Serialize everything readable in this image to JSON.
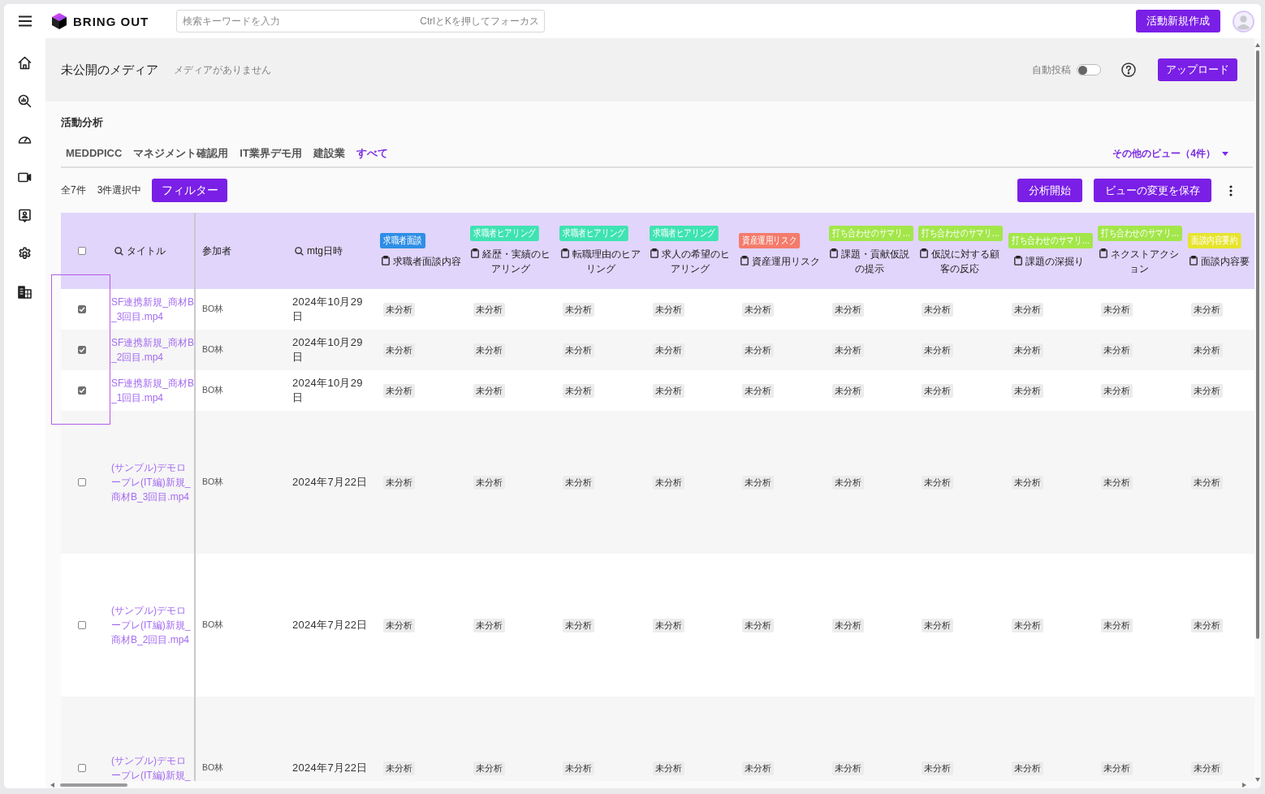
{
  "top_bar": {
    "logo": "BRING OUT",
    "search": {
      "placeholder": "検索キーワードを入力",
      "shortcut_hint": "CtrlとKを押してフォーカス"
    },
    "create_button": "活動新規作成"
  },
  "media_header": {
    "title": "未公開のメディア",
    "note": "メディアがありません",
    "auto_post": {
      "label": "自動投稿",
      "on": false
    },
    "upload_button": "アップロード"
  },
  "analysis": {
    "title": "活動分析",
    "views": [
      {
        "label": "MEDDPICC",
        "selected": false
      },
      {
        "label": "マネジメント確認用",
        "selected": false
      },
      {
        "label": "IT業界デモ用",
        "selected": false
      },
      {
        "label": "建設業",
        "selected": false
      },
      {
        "label": "すべて",
        "selected": true
      }
    ],
    "more_views": "その他のビュー（4件）",
    "total": "全7件",
    "selected_count": "3件選択中",
    "filter_button": "フィルター",
    "buttons": [
      "分析開始",
      "ビューの変更を保存"
    ]
  },
  "table": {
    "all_checked": false,
    "annotation_frame": true,
    "columns": [
      {
        "kind": "search",
        "label": "タイトル"
      },
      {
        "kind": "plain",
        "label": "参加者"
      },
      {
        "kind": "search",
        "label": "mtg日時"
      },
      {
        "kind": "analysis",
        "tag": "求職者面談",
        "color": "#2e8ee6",
        "label": "求職者面談内容"
      },
      {
        "kind": "analysis",
        "tag": "求職者ヒアリング",
        "color": "#3fe3b2",
        "label": "経歴・実績のヒアリング"
      },
      {
        "kind": "analysis",
        "tag": "求職者ヒアリング",
        "color": "#3fe3b2",
        "label": "転職理由のヒアリング"
      },
      {
        "kind": "analysis",
        "tag": "求職者ヒアリング",
        "color": "#3fe3b2",
        "label": "求人の希望のヒアリング"
      },
      {
        "kind": "analysis",
        "tag": "資産運用リスク",
        "color": "#f47b6b",
        "label": "資産運用リスク"
      },
      {
        "kind": "analysis",
        "tag": "打ち合わせのサマリ…",
        "color": "#a3e64a",
        "label": "課題・貢献仮説の提示"
      },
      {
        "kind": "analysis",
        "tag": "打ち合わせのサマリ…",
        "color": "#a3e64a",
        "label": "仮説に対する顧客の反応"
      },
      {
        "kind": "analysis",
        "tag": "打ち合わせのサマリ…",
        "color": "#a3e64a",
        "label": "課題の深掘り"
      },
      {
        "kind": "analysis",
        "tag": "打ち合わせのサマリ…",
        "color": "#a3e64a",
        "label": "ネクストアクション"
      },
      {
        "kind": "analysis",
        "tag": "面談内容要約",
        "color": "#e6e42c",
        "label": "面談内容要"
      }
    ],
    "rows": [
      {
        "checked": true,
        "title": "SF連携新規_商材B_3回目.mp4",
        "participant": "BO林",
        "date": "2024年10月29日",
        "statuses": [
          "未分析",
          "未分析",
          "未分析",
          "未分析",
          "未分析",
          "未分析",
          "未分析",
          "未分析",
          "未分析",
          "未分析"
        ]
      },
      {
        "checked": true,
        "title": "SF連携新規_商材B_2回目.mp4",
        "participant": "BO林",
        "date": "2024年10月29日",
        "statuses": [
          "未分析",
          "未分析",
          "未分析",
          "未分析",
          "未分析",
          "未分析",
          "未分析",
          "未分析",
          "未分析",
          "未分析"
        ]
      },
      {
        "checked": true,
        "title": "SF連携新規_商材B_1回目.mp4",
        "participant": "BO林",
        "date": "2024年10月29日",
        "statuses": [
          "未分析",
          "未分析",
          "未分析",
          "未分析",
          "未分析",
          "未分析",
          "未分析",
          "未分析",
          "未分析",
          "未分析"
        ]
      },
      {
        "checked": false,
        "title": "(サンプル)デモロープレ(IT編)新規_商材B_3回目.mp4",
        "participant": "BO林",
        "date": "2024年7月22日",
        "statuses": [
          "未分析",
          "未分析",
          "未分析",
          "未分析",
          "未分析",
          "未分析",
          "未分析",
          "未分析",
          "未分析",
          "未分析"
        ]
      },
      {
        "checked": false,
        "title": "(サンプル)デモロープレ(IT編)新規_商材B_2回目.mp4",
        "participant": "BO林",
        "date": "2024年7月22日",
        "statuses": [
          "未分析",
          "未分析",
          "未分析",
          "未分析",
          "未分析",
          "未分析",
          "未分析",
          "未分析",
          "未分析",
          "未分析"
        ]
      },
      {
        "checked": false,
        "title": "(サンプル)デモロープレ(IT編)新規_",
        "participant": "BO林",
        "date": "2024年7月22日",
        "statuses": [
          "未分析",
          "未分析",
          "未分析",
          "未分析",
          "未分析",
          "未分析",
          "未分析",
          "未分析",
          "未分析",
          "未分析"
        ]
      }
    ]
  }
}
